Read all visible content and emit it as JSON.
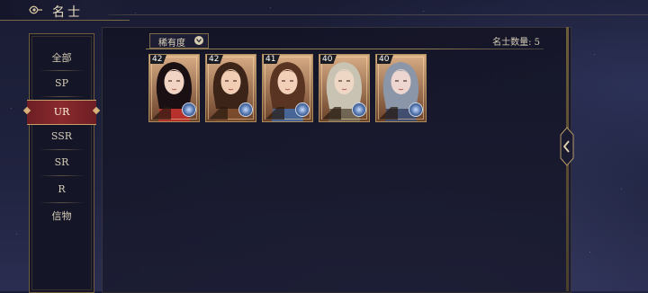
{
  "header": {
    "title": "名士"
  },
  "sidebar": {
    "items": [
      {
        "label": "全部",
        "active": false
      },
      {
        "label": "SP",
        "active": false
      },
      {
        "label": "UR",
        "active": true
      },
      {
        "label": "SSR",
        "active": false
      },
      {
        "label": "SR",
        "active": false
      },
      {
        "label": "R",
        "active": false
      },
      {
        "label": "信物",
        "active": false
      }
    ]
  },
  "filter": {
    "label": "稀有度"
  },
  "summary": {
    "count_label": "名士数量: 5"
  },
  "cards": [
    {
      "level": "42",
      "hair": "#1a1014",
      "skin": "#f1d4c4",
      "accent": "#c22b2b"
    },
    {
      "level": "42",
      "hair": "#3c2418",
      "skin": "#f0cdb3",
      "accent": "#7a4a2a"
    },
    {
      "level": "41",
      "hair": "#5a3422",
      "skin": "#f2d0b8",
      "accent": "#3f6aa8"
    },
    {
      "level": "40",
      "hair": "#c8c3b3",
      "skin": "#efd7c5",
      "accent": "#6f6a58"
    },
    {
      "level": "40",
      "hair": "#8b96a8",
      "skin": "#ecd6cf",
      "accent": "#3a4f7a"
    }
  ],
  "colors": {
    "accent_red": "#8a2a2e",
    "gold": "#c79f68",
    "panel": "#141527"
  }
}
